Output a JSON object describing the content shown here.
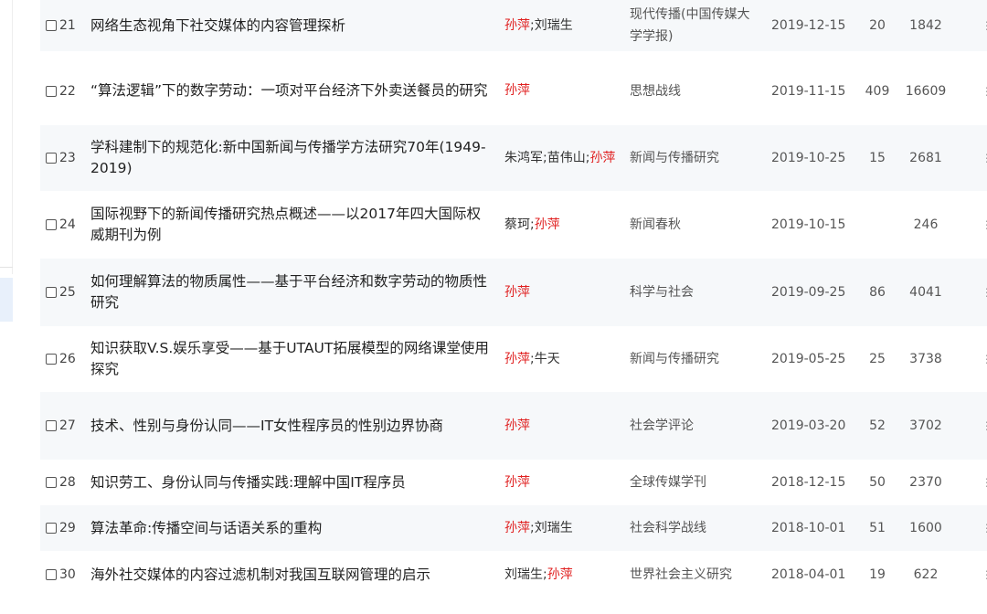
{
  "rows": [
    {
      "num": "21",
      "title": "网络生态视角下社交媒体的内容管理探析",
      "authors": [
        {
          "name": "孙萍",
          "red": true
        },
        {
          "name": "刘瑞生",
          "red": false
        }
      ],
      "source": "现代传播(中国传媒大学学报)",
      "date": "2019-12-15",
      "cited": "20",
      "downloads": "1842"
    },
    {
      "num": "22",
      "title": "“算法逻辑”下的数字劳动：一项对平台经济下外卖送餐员的研究",
      "authors": [
        {
          "name": "孙萍",
          "red": true
        }
      ],
      "source": "思想战线",
      "date": "2019-11-15",
      "cited": "409",
      "downloads": "16609"
    },
    {
      "num": "23",
      "title": "学科建制下的规范化:新中国新闻与传播学方法研究70年(1949-2019)",
      "authors": [
        {
          "name": "朱鸿军",
          "red": false
        },
        {
          "name": "苗伟山",
          "red": false
        },
        {
          "name": "孙萍",
          "red": true
        }
      ],
      "source": "新闻与传播研究",
      "date": "2019-10-25",
      "cited": "15",
      "downloads": "2681"
    },
    {
      "num": "24",
      "title": "国际视野下的新闻传播研究热点概述——以2017年四大国际权威期刊为例",
      "authors": [
        {
          "name": "蔡珂",
          "red": false
        },
        {
          "name": "孙萍",
          "red": true
        }
      ],
      "source": "新闻春秋",
      "date": "2019-10-15",
      "cited": "",
      "downloads": "246"
    },
    {
      "num": "25",
      "title": "如何理解算法的物质属性——基于平台经济和数字劳动的物质性研究",
      "authors": [
        {
          "name": "孙萍",
          "red": true
        }
      ],
      "source": "科学与社会",
      "date": "2019-09-25",
      "cited": "86",
      "downloads": "4041"
    },
    {
      "num": "26",
      "title": "知识获取V.S.娱乐享受——基于UTAUT拓展模型的网络课堂使用探究",
      "authors": [
        {
          "name": "孙萍",
          "red": true
        },
        {
          "name": "牛天",
          "red": false
        }
      ],
      "source": "新闻与传播研究",
      "date": "2019-05-25",
      "cited": "25",
      "downloads": "3738"
    },
    {
      "num": "27",
      "title": "技术、性别与身份认同——IT女性程序员的性别边界协商",
      "authors": [
        {
          "name": "孙萍",
          "red": true
        }
      ],
      "source": "社会学评论",
      "date": "2019-03-20",
      "cited": "52",
      "downloads": "3702"
    },
    {
      "num": "28",
      "title": "知识劳工、身份认同与传播实践:理解中国IT程序员",
      "authors": [
        {
          "name": "孙萍",
          "red": true
        }
      ],
      "source": "全球传媒学刊",
      "date": "2018-12-15",
      "cited": "50",
      "downloads": "2370"
    },
    {
      "num": "29",
      "title": "算法革命:传播空间与话语关系的重构",
      "authors": [
        {
          "name": "孙萍",
          "red": true
        },
        {
          "name": "刘瑞生",
          "red": false
        }
      ],
      "source": "社会科学战线",
      "date": "2018-10-01",
      "cited": "51",
      "downloads": "1600"
    },
    {
      "num": "30",
      "title": "海外社交媒体的内容过滤机制对我国互联网管理的启示",
      "authors": [
        {
          "name": "刘瑞生",
          "red": false
        },
        {
          "name": "孙萍",
          "red": true
        }
      ],
      "source": "世界社会主义研究",
      "date": "2018-04-01",
      "cited": "19",
      "downloads": "622"
    }
  ],
  "more_glyph": "⋮",
  "author_separator": ";",
  "colors": {
    "author_highlight": "#e02020",
    "row_alt_bg": "#f6f8fa"
  }
}
